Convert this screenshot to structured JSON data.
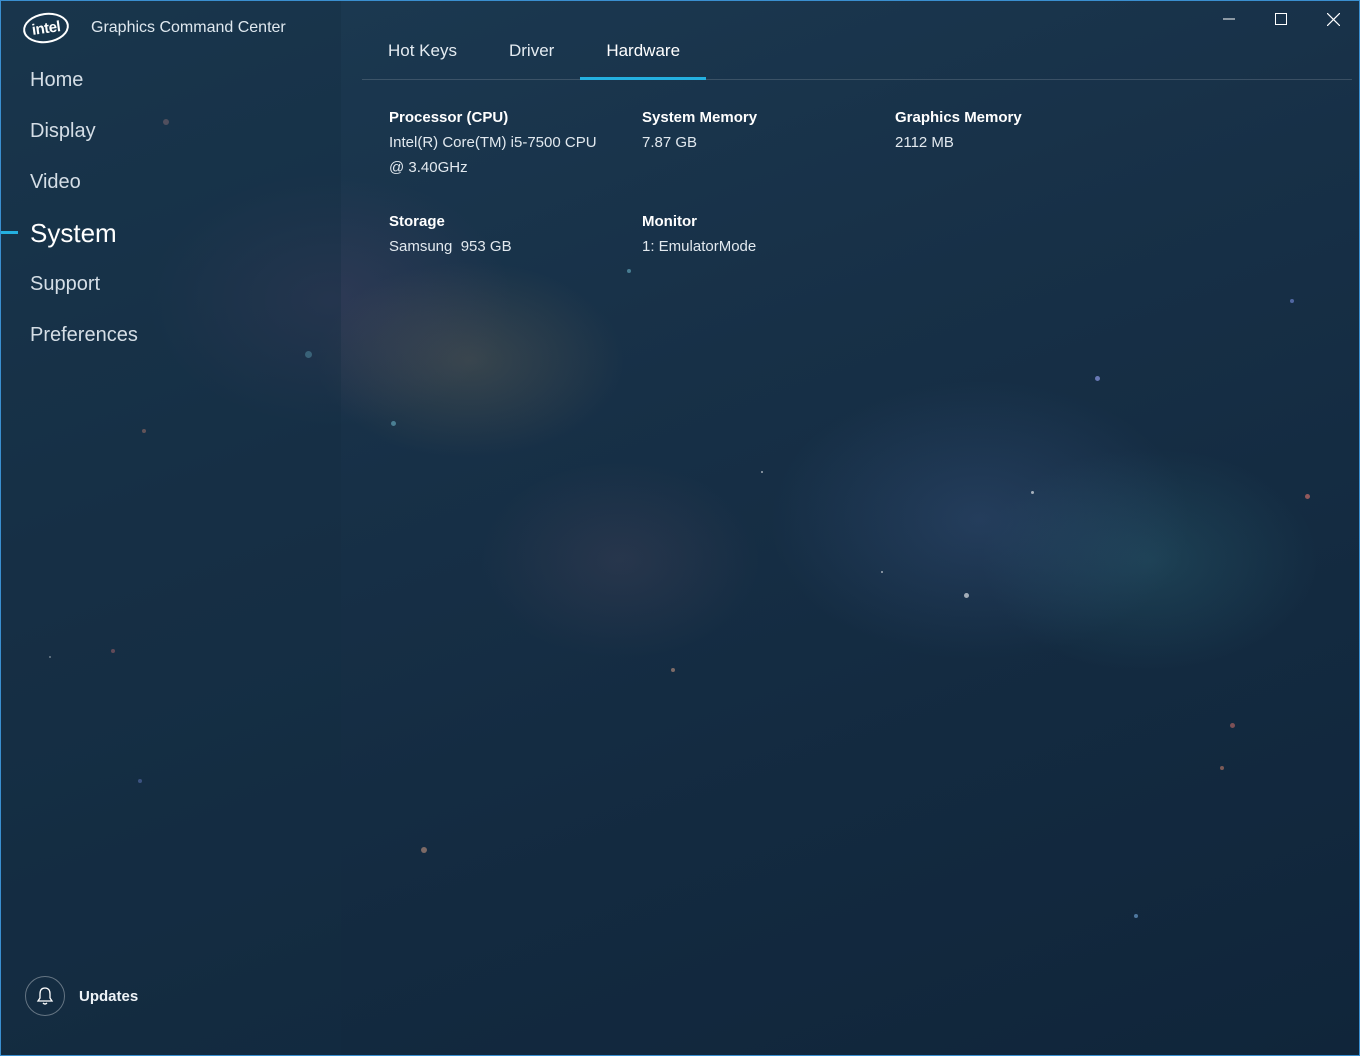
{
  "app": {
    "logo_text": "intel",
    "title": "Graphics Command Center"
  },
  "sidebar": {
    "items": [
      {
        "label": "Home"
      },
      {
        "label": "Display"
      },
      {
        "label": "Video"
      },
      {
        "label": "System"
      },
      {
        "label": "Support"
      },
      {
        "label": "Preferences"
      }
    ],
    "active": "System",
    "updates_label": "Updates"
  },
  "tabs": {
    "items": [
      {
        "label": "Hot Keys"
      },
      {
        "label": "Driver"
      },
      {
        "label": "Hardware"
      }
    ],
    "active": "Hardware"
  },
  "hardware": {
    "cpu": {
      "label": "Processor (CPU)",
      "value_line1": "Intel(R) Core(TM) i5-7500 CPU",
      "value_line2": "@ 3.40GHz"
    },
    "system_memory": {
      "label": "System Memory",
      "value": "7.87 GB"
    },
    "graphics_memory": {
      "label": "Graphics Memory",
      "value": "2112 MB"
    },
    "storage": {
      "label": "Storage",
      "value": "Samsung  953 GB"
    },
    "monitor": {
      "label": "Monitor",
      "value": "1: EmulatorMode"
    }
  },
  "colors": {
    "accent": "#24b0e0",
    "background": "#173047"
  },
  "icons": {
    "logo": "intel-logo-icon",
    "bell": "bell-icon",
    "minimize": "minimize-icon",
    "maximize": "maximize-icon",
    "close": "close-icon"
  }
}
